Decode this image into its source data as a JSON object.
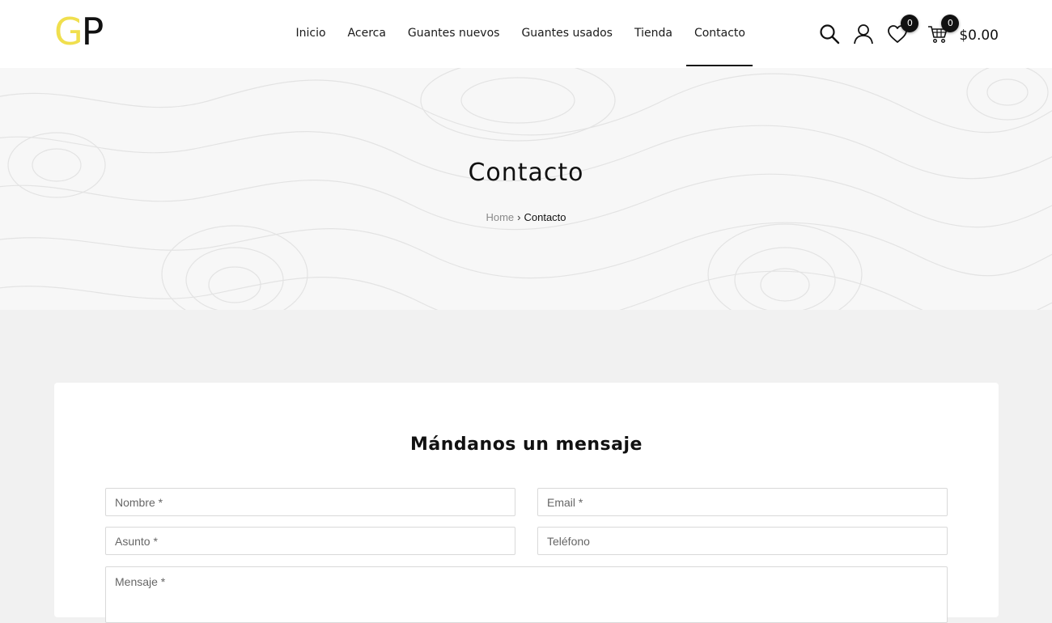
{
  "logo": {
    "letter1": "G",
    "letter2": "P"
  },
  "nav": {
    "items": [
      {
        "label": "Inicio"
      },
      {
        "label": "Acerca"
      },
      {
        "label": "Guantes nuevos"
      },
      {
        "label": "Guantes usados"
      },
      {
        "label": "Tienda"
      },
      {
        "label": "Contacto",
        "active": true
      }
    ]
  },
  "header_icons": {
    "search": "search-icon",
    "account": "user-icon",
    "wishlist": {
      "icon": "heart-icon",
      "count": "0"
    },
    "cart": {
      "icon": "cart-icon",
      "count": "0",
      "total": "$0.00"
    }
  },
  "hero": {
    "title": "Contacto",
    "breadcrumb": {
      "home": "Home",
      "separator": "›",
      "current": "Contacto"
    }
  },
  "form": {
    "title": "Mándanos un mensaje",
    "name_placeholder": "Nombre *",
    "email_placeholder": "Email *",
    "subject_placeholder": "Asunto *",
    "phone_placeholder": "Teléfono",
    "message_placeholder": "Mensaje *"
  },
  "colors": {
    "logo_accent": "#f0df4e",
    "text": "#111111",
    "hero_bg": "#f7f7f7",
    "page_bg": "#f1f1f1"
  }
}
